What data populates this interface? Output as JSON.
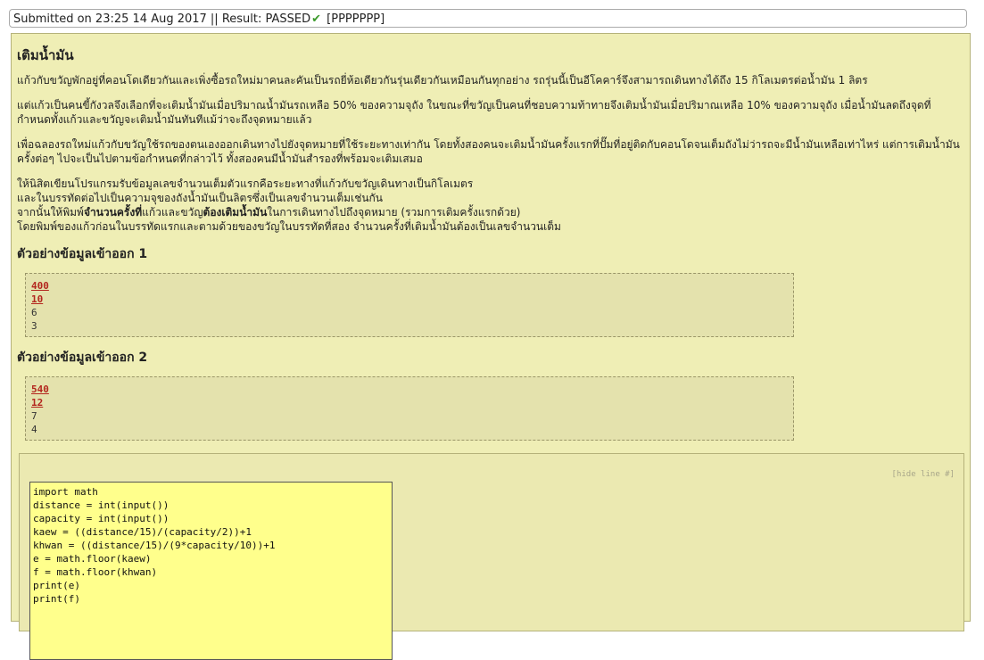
{
  "submission": {
    "status_text": "Submitted on 23:25 14 Aug 2017 || Result: PASSED",
    "result_detail": "[PPPPPPP]"
  },
  "problem": {
    "title": "เติมน้ำมัน",
    "paragraphs": [
      "แก้วกับขวัญพักอยู่ที่คอนโดเดียวกันและเพิ่งซื้อรถใหม่มาคนละคันเป็นรถยี่ห้อเดียวกันรุ่นเดียวกันเหมือนกันทุกอย่าง รถรุ่นนี้เป็นอีโคคาร์จึงสามารถเดินทางได้ถึง 15 กิโลเมตรต่อน้ำมัน 1 ลิตร",
      "แต่แก้วเป็นคนขี้กังวลจึงเลือกที่จะเติมน้ำมันเมื่อปริมาณน้ำมันรถเหลือ 50% ของความจุถัง ในขณะที่ขวัญเป็นคนที่ชอบความท้าทายจึงเติมน้ำมันเมื่อปริมาณเหลือ 10% ของความจุถัง เมื่อน้ำมันลดถึงจุดที่กำหนดทั้งแก้วและขวัญจะเติมน้ำมันทันทีแม้ว่าจะถึงจุดหมายแล้ว",
      "เพื่อฉลองรถใหม่แก้วกับขวัญใช้รถของตนเองออกเดินทางไปยังจุดหมายที่ใช้ระยะทางเท่ากัน โดยทั้งสองคนจะเติมน้ำมันครั้งแรกที่ปั๊มที่อยู่ติดกับคอนโดจนเต็มถังไม่ว่ารถจะมีน้ำมันเหลือเท่าไหร่ แต่การเติมน้ำมันครั้งต่อๆ ไปจะเป็นไปตามข้อกำหนดที่กล่าวไว้ ทั้งสองคนมีน้ำมันสำรองที่พร้อมจะเติมเสมอ"
    ],
    "instr1": "ให้นิสิตเขียนโปรแกรมรับข้อมูลเลขจำนวนเต็มตัวแรกคือระยะทางที่แก้วกับขวัญเดินทางเป็นกิโลเมตร",
    "instr2": "และในบรรทัดต่อไปเป็นความจุของถังน้ำมันเป็นลิตรซึ่งเป็นเลขจำนวนเต็มเช่นกัน",
    "instr3_a": "จากนั้นให้พิมพ์",
    "instr3_b": "จำนวนครั้งที่",
    "instr3_c": "แก้วและขวัญ",
    "instr3_d": "ต้องเติมน้ำมัน",
    "instr3_e": "ในการเดินทางไปถึงจุดหมาย (รวมการเติมครั้งแรกด้วย)",
    "instr4": "โดยพิมพ์ของแก้วก่อนในบรรทัดแรกและตามด้วยของขวัญในบรรทัดที่สอง จำนวนครั้งที่เติมน้ำมันต้องเป็นเลขจำนวนเต็ม"
  },
  "examples": [
    {
      "heading": "ตัวอย่างข้อมูลเข้าออก 1",
      "inputs": [
        "400",
        "10"
      ],
      "outputs": [
        "6",
        "3"
      ]
    },
    {
      "heading": "ตัวอย่างข้อมูลเข้าออก 2",
      "inputs": [
        "540",
        "12"
      ],
      "outputs": [
        "7",
        "4"
      ]
    }
  ],
  "code_panel": {
    "hide_label": "[hide line #]",
    "lines": [
      "import math",
      "distance = int(input())",
      "capacity = int(input())",
      "kaew = ((distance/15)/(capacity/2))+1",
      "khwan = ((distance/15)/(9*capacity/10))+1",
      "e = math.floor(kaew)",
      "f = math.floor(khwan)",
      "print(e)",
      "print(f)"
    ]
  },
  "colors": {
    "panel_bg": "#efeeb5",
    "code_bg": "#ffff8c",
    "input_red": "#b3261e",
    "pass_green": "#3a9a2a"
  },
  "icons": {
    "result": "check-icon"
  }
}
